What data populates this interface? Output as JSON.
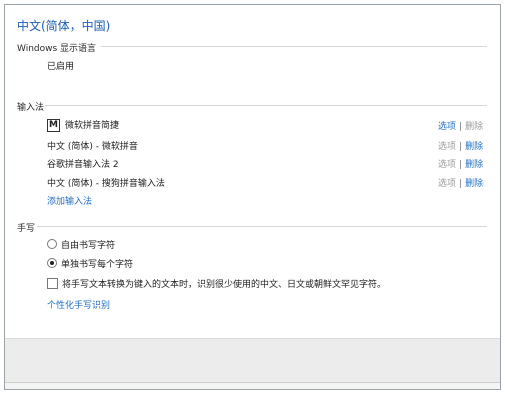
{
  "page_title": "中文(简体，中国)",
  "display_language": {
    "section_label": "Windows 显示语言",
    "status": "已启用"
  },
  "input_methods": {
    "section_label": "输入法",
    "ime_badge": "M",
    "items": [
      {
        "name": "微软拼音简捷",
        "options": "选项",
        "remove": "删除"
      },
      {
        "name": "中文 (简体) - 微软拼音",
        "options": "选项",
        "remove": "删除"
      },
      {
        "name": "谷歌拼音输入法 2",
        "options": "选项",
        "remove": "删除"
      },
      {
        "name": "中文 (简体) - 搜狗拼音输入法",
        "options": "选项",
        "remove": "删除"
      }
    ],
    "separator": "|",
    "add_label": "添加输入法"
  },
  "handwriting": {
    "section_label": "手写",
    "options": [
      {
        "label": "自由书写字符",
        "checked": false
      },
      {
        "label": "单独书写每个字符",
        "checked": true
      }
    ],
    "checkbox_label": "将手写文本转换为键入的文本时，识别很少使用的中文、日文或朝鲜文罕见字符。",
    "checkbox_checked": false,
    "personalize_link": "个性化手写识别"
  },
  "colors": {
    "title_blue": "#1a5fb4",
    "link_blue": "#1f6fc5",
    "muted_gray": "#9a9a9a"
  }
}
